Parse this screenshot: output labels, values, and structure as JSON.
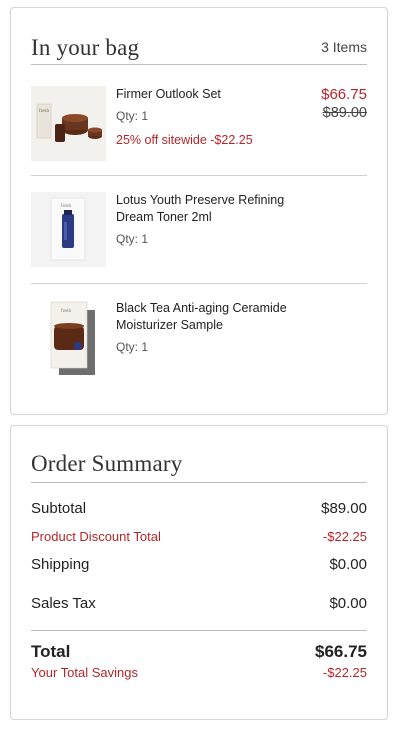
{
  "bag": {
    "title": "In your bag",
    "count": "3 Items",
    "items": [
      {
        "name": "Firmer Outlook Set",
        "qty": "Qty: 1",
        "promo": "25% off sitewide -$22.25",
        "price": "$66.75",
        "original_price": "$89.00",
        "thumb_icon": "skincare-set-image"
      },
      {
        "name": "Lotus Youth Preserve Refining Dream Toner 2ml",
        "qty": "Qty: 1",
        "thumb_icon": "toner-sample-image"
      },
      {
        "name": "Black Tea Anti-aging Ceramide Moisturizer Sample",
        "qty": "Qty: 1",
        "thumb_icon": "moisturizer-sample-image"
      }
    ]
  },
  "summary": {
    "title": "Order Summary",
    "subtotal_label": "Subtotal",
    "subtotal_value": "$89.00",
    "discount_label": "Product Discount Total",
    "discount_value": "-$22.25",
    "shipping_label": "Shipping",
    "shipping_value": "$0.00",
    "tax_label": "Sales Tax",
    "tax_value": "$0.00",
    "total_label": "Total",
    "total_value": "$66.75",
    "savings_label": "Your Total Savings",
    "savings_value": "-$22.25"
  },
  "colors": {
    "accent_red": "#b3262b",
    "border": "#d4d4d4"
  }
}
